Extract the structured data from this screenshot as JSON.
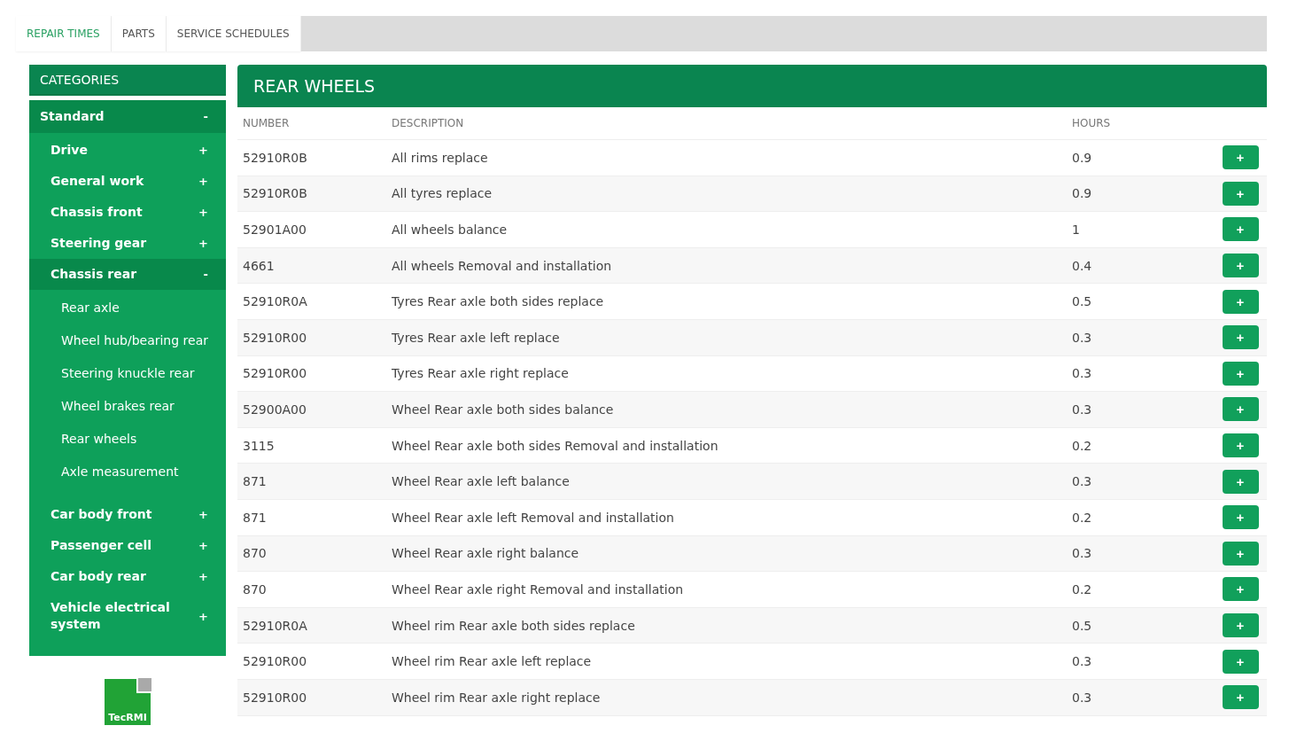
{
  "tabs": [
    {
      "label": "REPAIR TIMES",
      "selected": true
    },
    {
      "label": "PARTS",
      "selected": false
    },
    {
      "label": "SERVICE SCHEDULES",
      "selected": false
    }
  ],
  "sidebar": {
    "title": "CATEGORIES",
    "items": [
      {
        "label": "Standard",
        "toggle": "-",
        "expanded": true,
        "children": [
          {
            "label": "Drive",
            "toggle": "+",
            "expanded": false
          },
          {
            "label": "General work",
            "toggle": "+",
            "expanded": false
          },
          {
            "label": "Chassis front",
            "toggle": "+",
            "expanded": false
          },
          {
            "label": "Steering gear",
            "toggle": "+",
            "expanded": false
          },
          {
            "label": "Chassis rear",
            "toggle": "-",
            "expanded": true,
            "children": [
              {
                "label": "Rear axle"
              },
              {
                "label": "Wheel hub/bearing rear"
              },
              {
                "label": "Steering knuckle rear"
              },
              {
                "label": "Wheel brakes rear"
              },
              {
                "label": "Rear wheels"
              },
              {
                "label": "Axle measurement"
              }
            ]
          },
          {
            "label": "Car body front",
            "toggle": "+",
            "expanded": false
          },
          {
            "label": "Passenger cell",
            "toggle": "+",
            "expanded": false
          },
          {
            "label": "Car body rear",
            "toggle": "+",
            "expanded": false
          },
          {
            "label": "Vehicle electrical system",
            "toggle": "+",
            "expanded": false
          }
        ]
      }
    ]
  },
  "logo": {
    "text": "TecRMI"
  },
  "table": {
    "title": "REAR WHEELS",
    "columns": [
      "NUMBER",
      "DESCRIPTION",
      "HOURS"
    ],
    "add_label": "+",
    "rows": [
      {
        "number": "52910R0B",
        "description": "All rims replace",
        "hours": "0.9"
      },
      {
        "number": "52910R0B",
        "description": "All tyres replace",
        "hours": "0.9"
      },
      {
        "number": "52901A00",
        "description": "All wheels balance",
        "hours": "1"
      },
      {
        "number": "4661",
        "description": "All wheels Removal and installation",
        "hours": "0.4"
      },
      {
        "number": "52910R0A",
        "description": "Tyres Rear axle both sides replace",
        "hours": "0.5"
      },
      {
        "number": "52910R00",
        "description": "Tyres Rear axle left replace",
        "hours": "0.3"
      },
      {
        "number": "52910R00",
        "description": "Tyres Rear axle right replace",
        "hours": "0.3"
      },
      {
        "number": "52900A00",
        "description": "Wheel Rear axle both sides balance",
        "hours": "0.3"
      },
      {
        "number": "3115",
        "description": "Wheel Rear axle both sides Removal and installation",
        "hours": "0.2"
      },
      {
        "number": "871",
        "description": "Wheel Rear axle left balance",
        "hours": "0.3"
      },
      {
        "number": "871",
        "description": "Wheel Rear axle left Removal and installation",
        "hours": "0.2"
      },
      {
        "number": "870",
        "description": "Wheel Rear axle right balance",
        "hours": "0.3"
      },
      {
        "number": "870",
        "description": "Wheel Rear axle right Removal and installation",
        "hours": "0.2"
      },
      {
        "number": "52910R0A",
        "description": "Wheel rim Rear axle both sides replace",
        "hours": "0.5"
      },
      {
        "number": "52910R00",
        "description": "Wheel rim Rear axle left replace",
        "hours": "0.3"
      },
      {
        "number": "52910R00",
        "description": "Wheel rim Rear axle right replace",
        "hours": "0.3"
      }
    ]
  }
}
